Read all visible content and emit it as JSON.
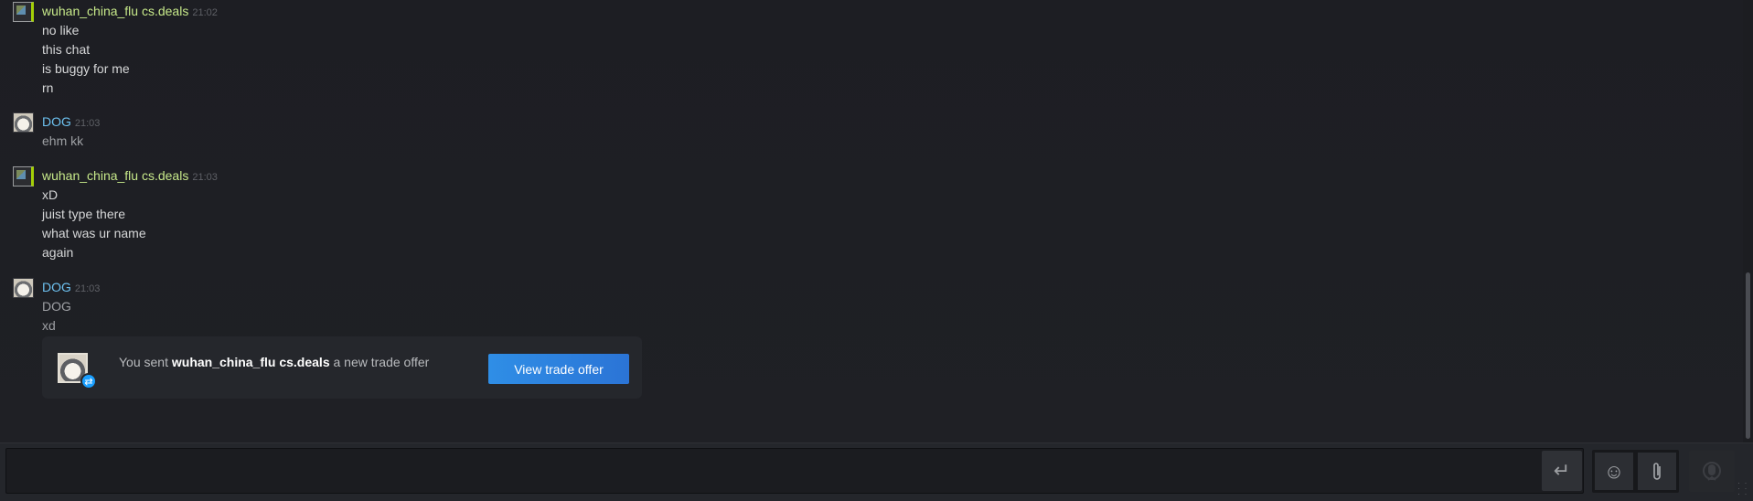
{
  "messages": [
    {
      "author": "wuhan_china_flu cs.deals",
      "time": "21:02",
      "lines": [
        "no like",
        "this chat",
        "is buggy for me",
        "rn"
      ]
    },
    {
      "author": "DOG",
      "time": "21:03",
      "lines": [
        "ehm kk"
      ]
    },
    {
      "author": "wuhan_china_flu cs.deals",
      "time": "21:03",
      "lines": [
        "xD",
        "juist type there",
        "what was ur name",
        "again"
      ]
    },
    {
      "author": "DOG",
      "time": "21:03",
      "lines": [
        "DOG",
        "xd"
      ]
    }
  ],
  "trade_offer": {
    "prefix": "You sent",
    "recipient": "wuhan_china_flu cs.deals",
    "suffix": "a new trade offer",
    "button_label": "View trade offer"
  },
  "input": {
    "value": "",
    "send_icon": "↵",
    "emoji_icon": "☺",
    "attach_icon": "paperclip-icon",
    "voice_icon": "microphone-icon"
  },
  "colors": {
    "in_game_name": "#c7e98a",
    "online_name": "#6dc1f0",
    "accent_button": "#2f8ee6"
  }
}
